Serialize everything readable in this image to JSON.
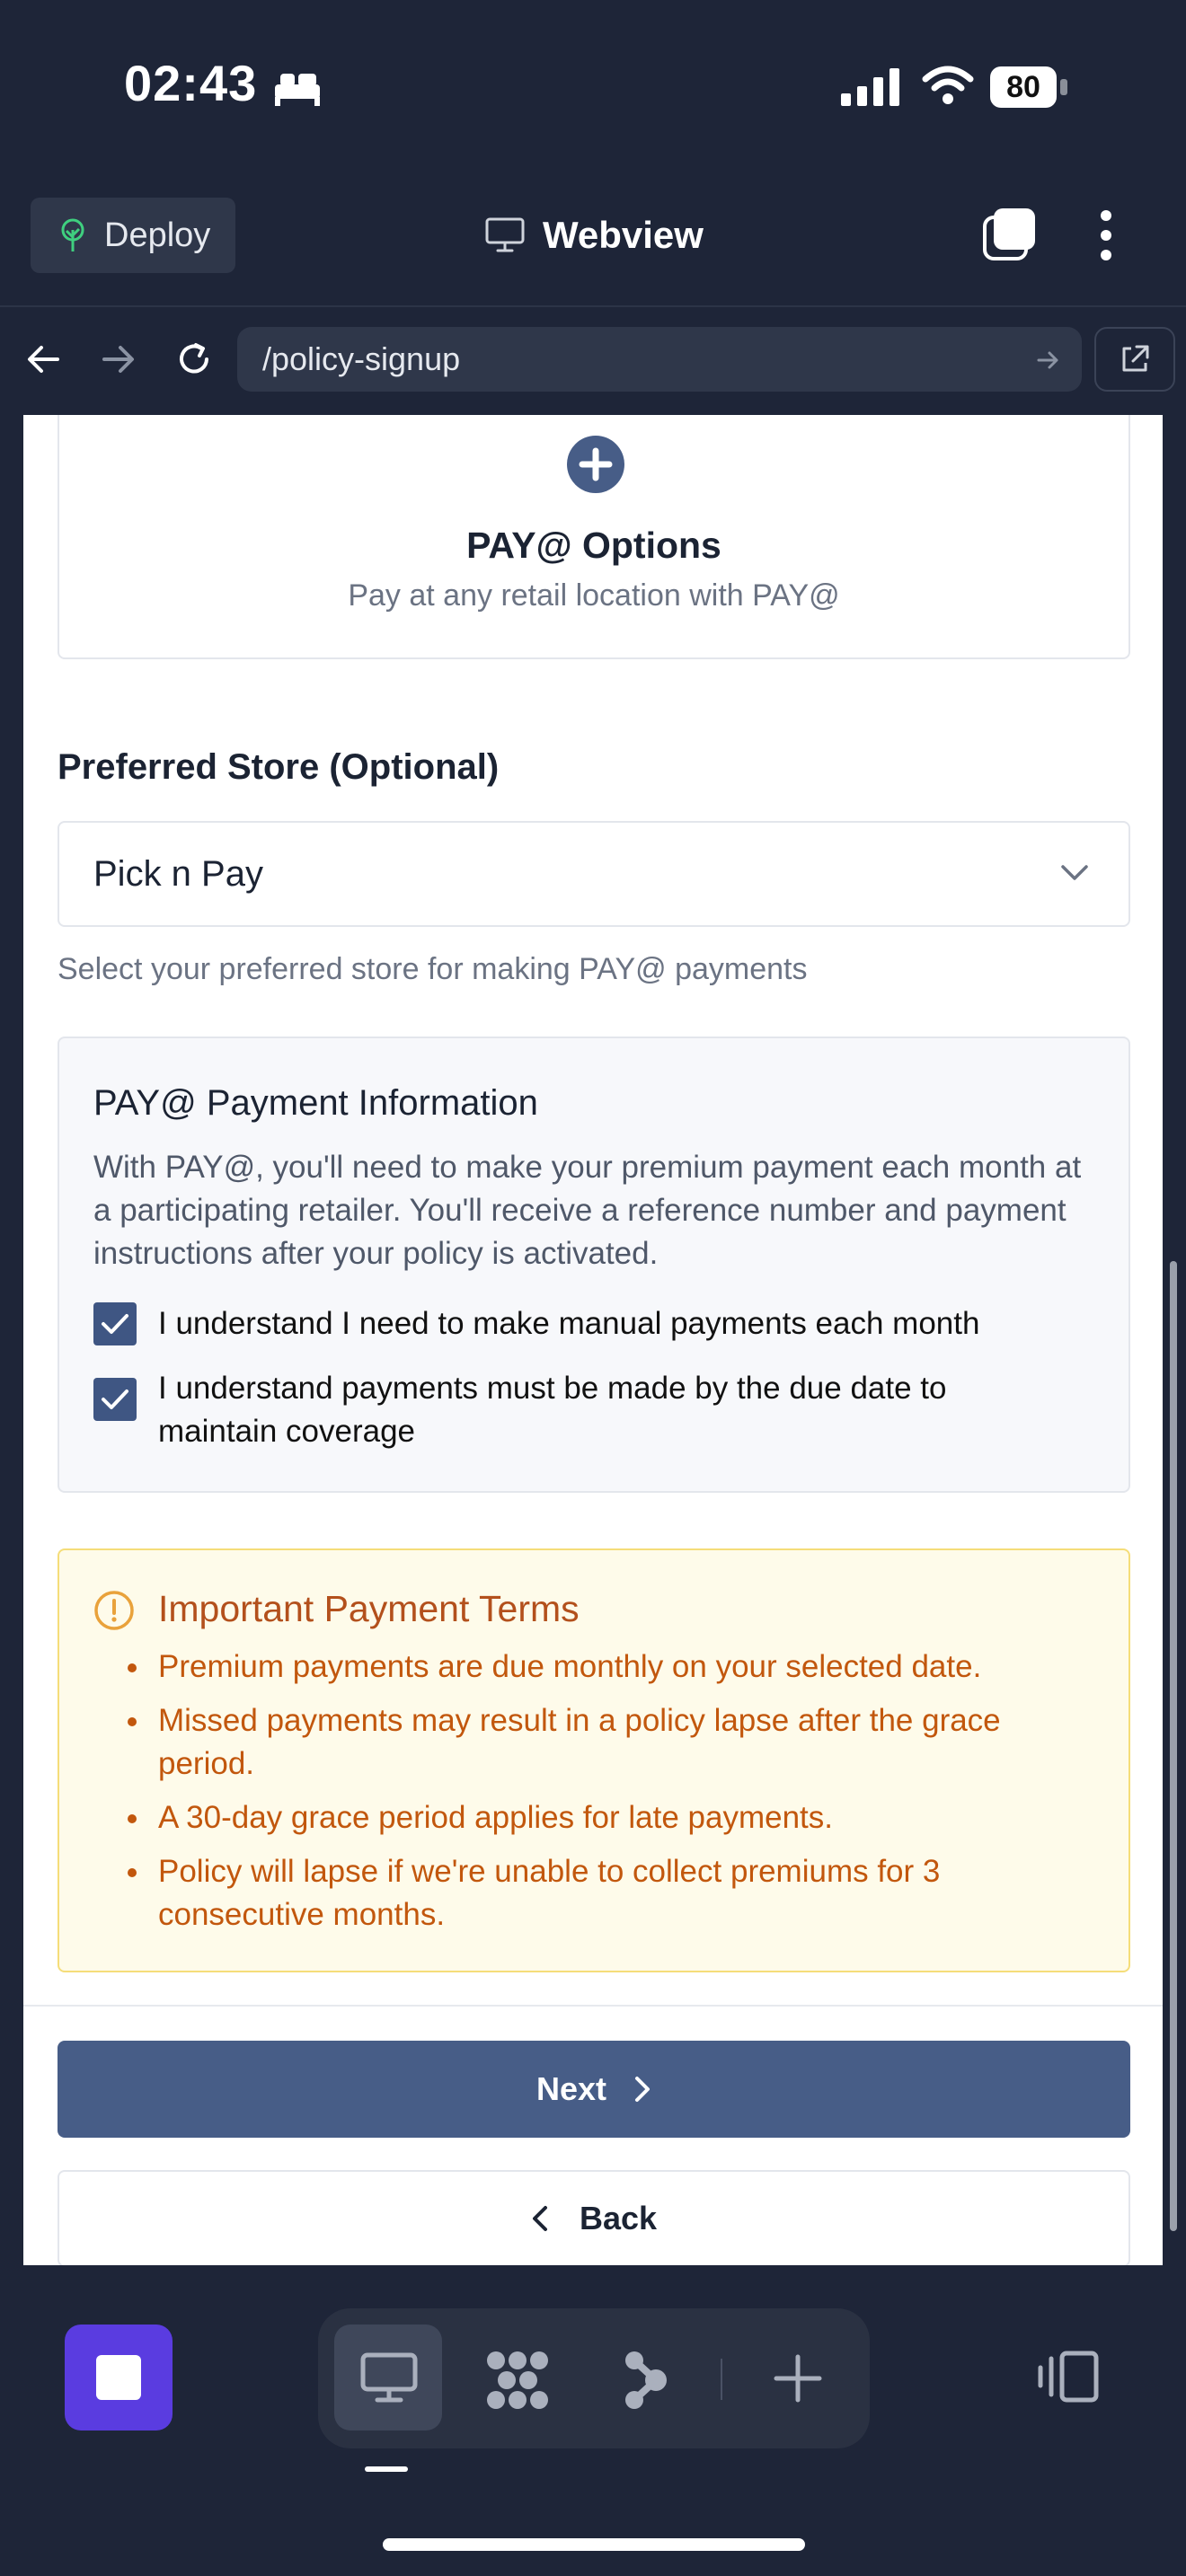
{
  "status_bar": {
    "time": "02:43",
    "battery": "80"
  },
  "toolbar": {
    "deploy_label": "Deploy",
    "title": "Webview"
  },
  "browser": {
    "url": "/policy-signup"
  },
  "payment_option": {
    "title": "PAY@ Options",
    "subtitle": "Pay at any retail location with PAY@"
  },
  "store_select": {
    "label": "Preferred Store (Optional)",
    "value": "Pick n Pay",
    "hint": "Select your preferred store for making PAY@ payments"
  },
  "info": {
    "title": "PAY@ Payment Information",
    "text": "With PAY@, you'll need to make your premium payment each month at a participating retailer. You'll receive a reference number and payment instructions after your policy is activated.",
    "checks": [
      {
        "label": "I understand I need to make manual payments each month",
        "checked": true
      },
      {
        "label": "I understand payments must be made by the due date to maintain coverage",
        "checked": true
      }
    ]
  },
  "terms": {
    "title": "Important Payment Terms",
    "items": [
      "Premium payments are due monthly on your selected date.",
      "Missed payments may result in a policy lapse after the grace period.",
      "A 30-day grace period applies for late payments.",
      "Policy will lapse if we're unable to collect premiums for 3 consecutive months."
    ]
  },
  "actions": {
    "next_label": "Next",
    "back_label": "Back"
  },
  "colors": {
    "primary": "#475d87",
    "warning_text": "#c2570d",
    "warning_bg": "#fefbea",
    "dock_accent": "#5a3ce0"
  }
}
